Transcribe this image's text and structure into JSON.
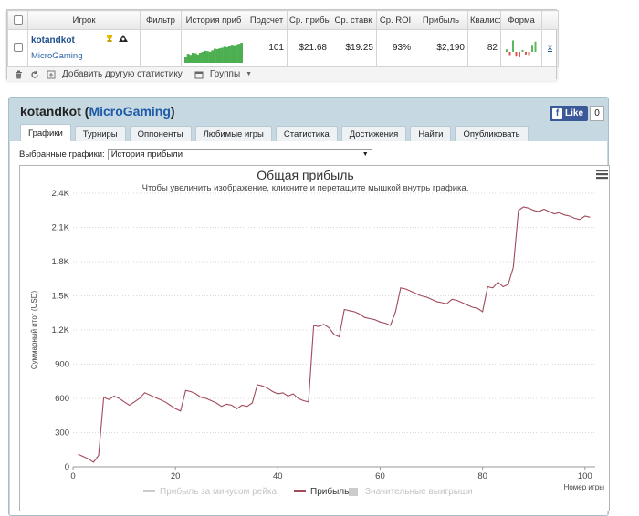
{
  "table": {
    "headers": [
      "Игрок",
      "Фильтр",
      "История приб",
      "Подсчет",
      "Ср. прибыль",
      "Ср. ставк",
      "Ср. ROI",
      "Прибыль",
      "Квалиф",
      "Форма"
    ],
    "row": {
      "player": "kotandkot",
      "network": "MicroGaming",
      "count": "101",
      "avg_profit": "$21.68",
      "avg_stake": "$19.25",
      "avg_roi": "93%",
      "profit": "$2,190",
      "qual": "82",
      "remove": "x"
    },
    "history_bars": [
      0.3,
      0.45,
      0.4,
      0.5,
      0.48,
      0.42,
      0.5,
      0.55,
      0.6,
      0.58,
      0.55,
      0.62,
      0.7,
      0.68,
      0.72,
      0.75,
      0.8,
      0.78,
      0.85,
      0.9,
      0.88,
      0.92,
      0.95,
      1.0
    ],
    "form": [
      {
        "h": 0.2,
        "dir": "pos",
        "color": "#5cb85c"
      },
      {
        "h": 0.25,
        "dir": "neg",
        "color": "#d9534f"
      },
      {
        "h": 0.9,
        "dir": "pos",
        "color": "#5cb85c"
      },
      {
        "h": 0.3,
        "dir": "neg",
        "color": "#d9534f"
      },
      {
        "h": 0.35,
        "dir": "neg",
        "color": "#d9534f"
      },
      {
        "h": 0.15,
        "dir": "pos",
        "color": "#5cb85c"
      },
      {
        "h": 0.2,
        "dir": "neg",
        "color": "#d9534f"
      },
      {
        "h": 0.25,
        "dir": "neg",
        "color": "#d9534f"
      },
      {
        "h": 0.55,
        "dir": "pos",
        "color": "#5cb85c"
      },
      {
        "h": 0.8,
        "dir": "pos",
        "color": "#5cb85c"
      }
    ]
  },
  "toolbar": {
    "add_stat": "Добавить другую статистику",
    "groups": "Группы"
  },
  "panel": {
    "player": "kotandkot",
    "network": "MicroGaming",
    "like": "Like",
    "like_count": "0",
    "tabs": [
      "Графики",
      "Турниры",
      "Оппоненты",
      "Любимые игры",
      "Статистика",
      "Достижения",
      "Найти",
      "Опубликовать"
    ],
    "selected_label": "Выбранные графики:",
    "selected_value": "История прибыли"
  },
  "chart_data": {
    "type": "line",
    "title": "Общая прибыль",
    "subtitle": "Чтобы увеличить изображение, кликните и перетащите мышкой внутрь графика.",
    "xlabel": "Номер игры",
    "ylabel": "Суммарный итог (USD)",
    "xlim": [
      0,
      102
    ],
    "ylim": [
      0,
      2400
    ],
    "xticks": [
      0,
      20,
      40,
      60,
      80,
      100
    ],
    "yticks": [
      0,
      300,
      600,
      900,
      1200,
      1500,
      1800,
      2100,
      2400
    ],
    "ytick_labels": [
      "0",
      "300",
      "600",
      "900",
      "1.2K",
      "1.5K",
      "1.8K",
      "2.1K",
      "2.4K"
    ],
    "legend": [
      {
        "name": "Прибыль за минусом рейка",
        "color": "#cccccc",
        "hidden": true
      },
      {
        "name": "Прибыль",
        "color": "#a04a5a",
        "hidden": false
      },
      {
        "name": "Значительные выигрыши",
        "color": "#cccccc",
        "hidden": true
      }
    ],
    "series": [
      {
        "name": "Прибыль",
        "color": "#a04a5a",
        "x": [
          1,
          2,
          3,
          4,
          5,
          6,
          7,
          8,
          9,
          10,
          11,
          12,
          13,
          14,
          15,
          16,
          17,
          18,
          19,
          20,
          21,
          22,
          23,
          24,
          25,
          26,
          27,
          28,
          29,
          30,
          31,
          32,
          33,
          34,
          35,
          36,
          37,
          38,
          39,
          40,
          41,
          42,
          43,
          44,
          45,
          46,
          47,
          48,
          49,
          50,
          51,
          52,
          53,
          54,
          55,
          56,
          57,
          58,
          59,
          60,
          61,
          62,
          63,
          64,
          65,
          66,
          67,
          68,
          69,
          70,
          71,
          72,
          73,
          74,
          75,
          76,
          77,
          78,
          79,
          80,
          81,
          82,
          83,
          84,
          85,
          86,
          87,
          88,
          89,
          90,
          91,
          92,
          93,
          94,
          95,
          96,
          97,
          98,
          99,
          100,
          101
        ],
        "y": [
          110,
          90,
          70,
          40,
          100,
          610,
          590,
          620,
          600,
          570,
          540,
          570,
          600,
          650,
          630,
          610,
          590,
          570,
          540,
          510,
          490,
          670,
          660,
          640,
          610,
          600,
          580,
          560,
          530,
          550,
          540,
          510,
          540,
          530,
          560,
          720,
          710,
          690,
          660,
          640,
          650,
          620,
          640,
          600,
          580,
          570,
          1240,
          1230,
          1250,
          1220,
          1160,
          1140,
          1380,
          1370,
          1360,
          1340,
          1310,
          1300,
          1290,
          1270,
          1260,
          1240,
          1360,
          1570,
          1560,
          1540,
          1520,
          1500,
          1490,
          1470,
          1450,
          1440,
          1430,
          1470,
          1460,
          1440,
          1420,
          1400,
          1390,
          1360,
          1580,
          1570,
          1620,
          1580,
          1600,
          1750,
          2250,
          2280,
          2270,
          2250,
          2240,
          2260,
          2240,
          2220,
          2230,
          2210,
          2200,
          2180,
          2170,
          2200,
          2190
        ]
      }
    ]
  }
}
